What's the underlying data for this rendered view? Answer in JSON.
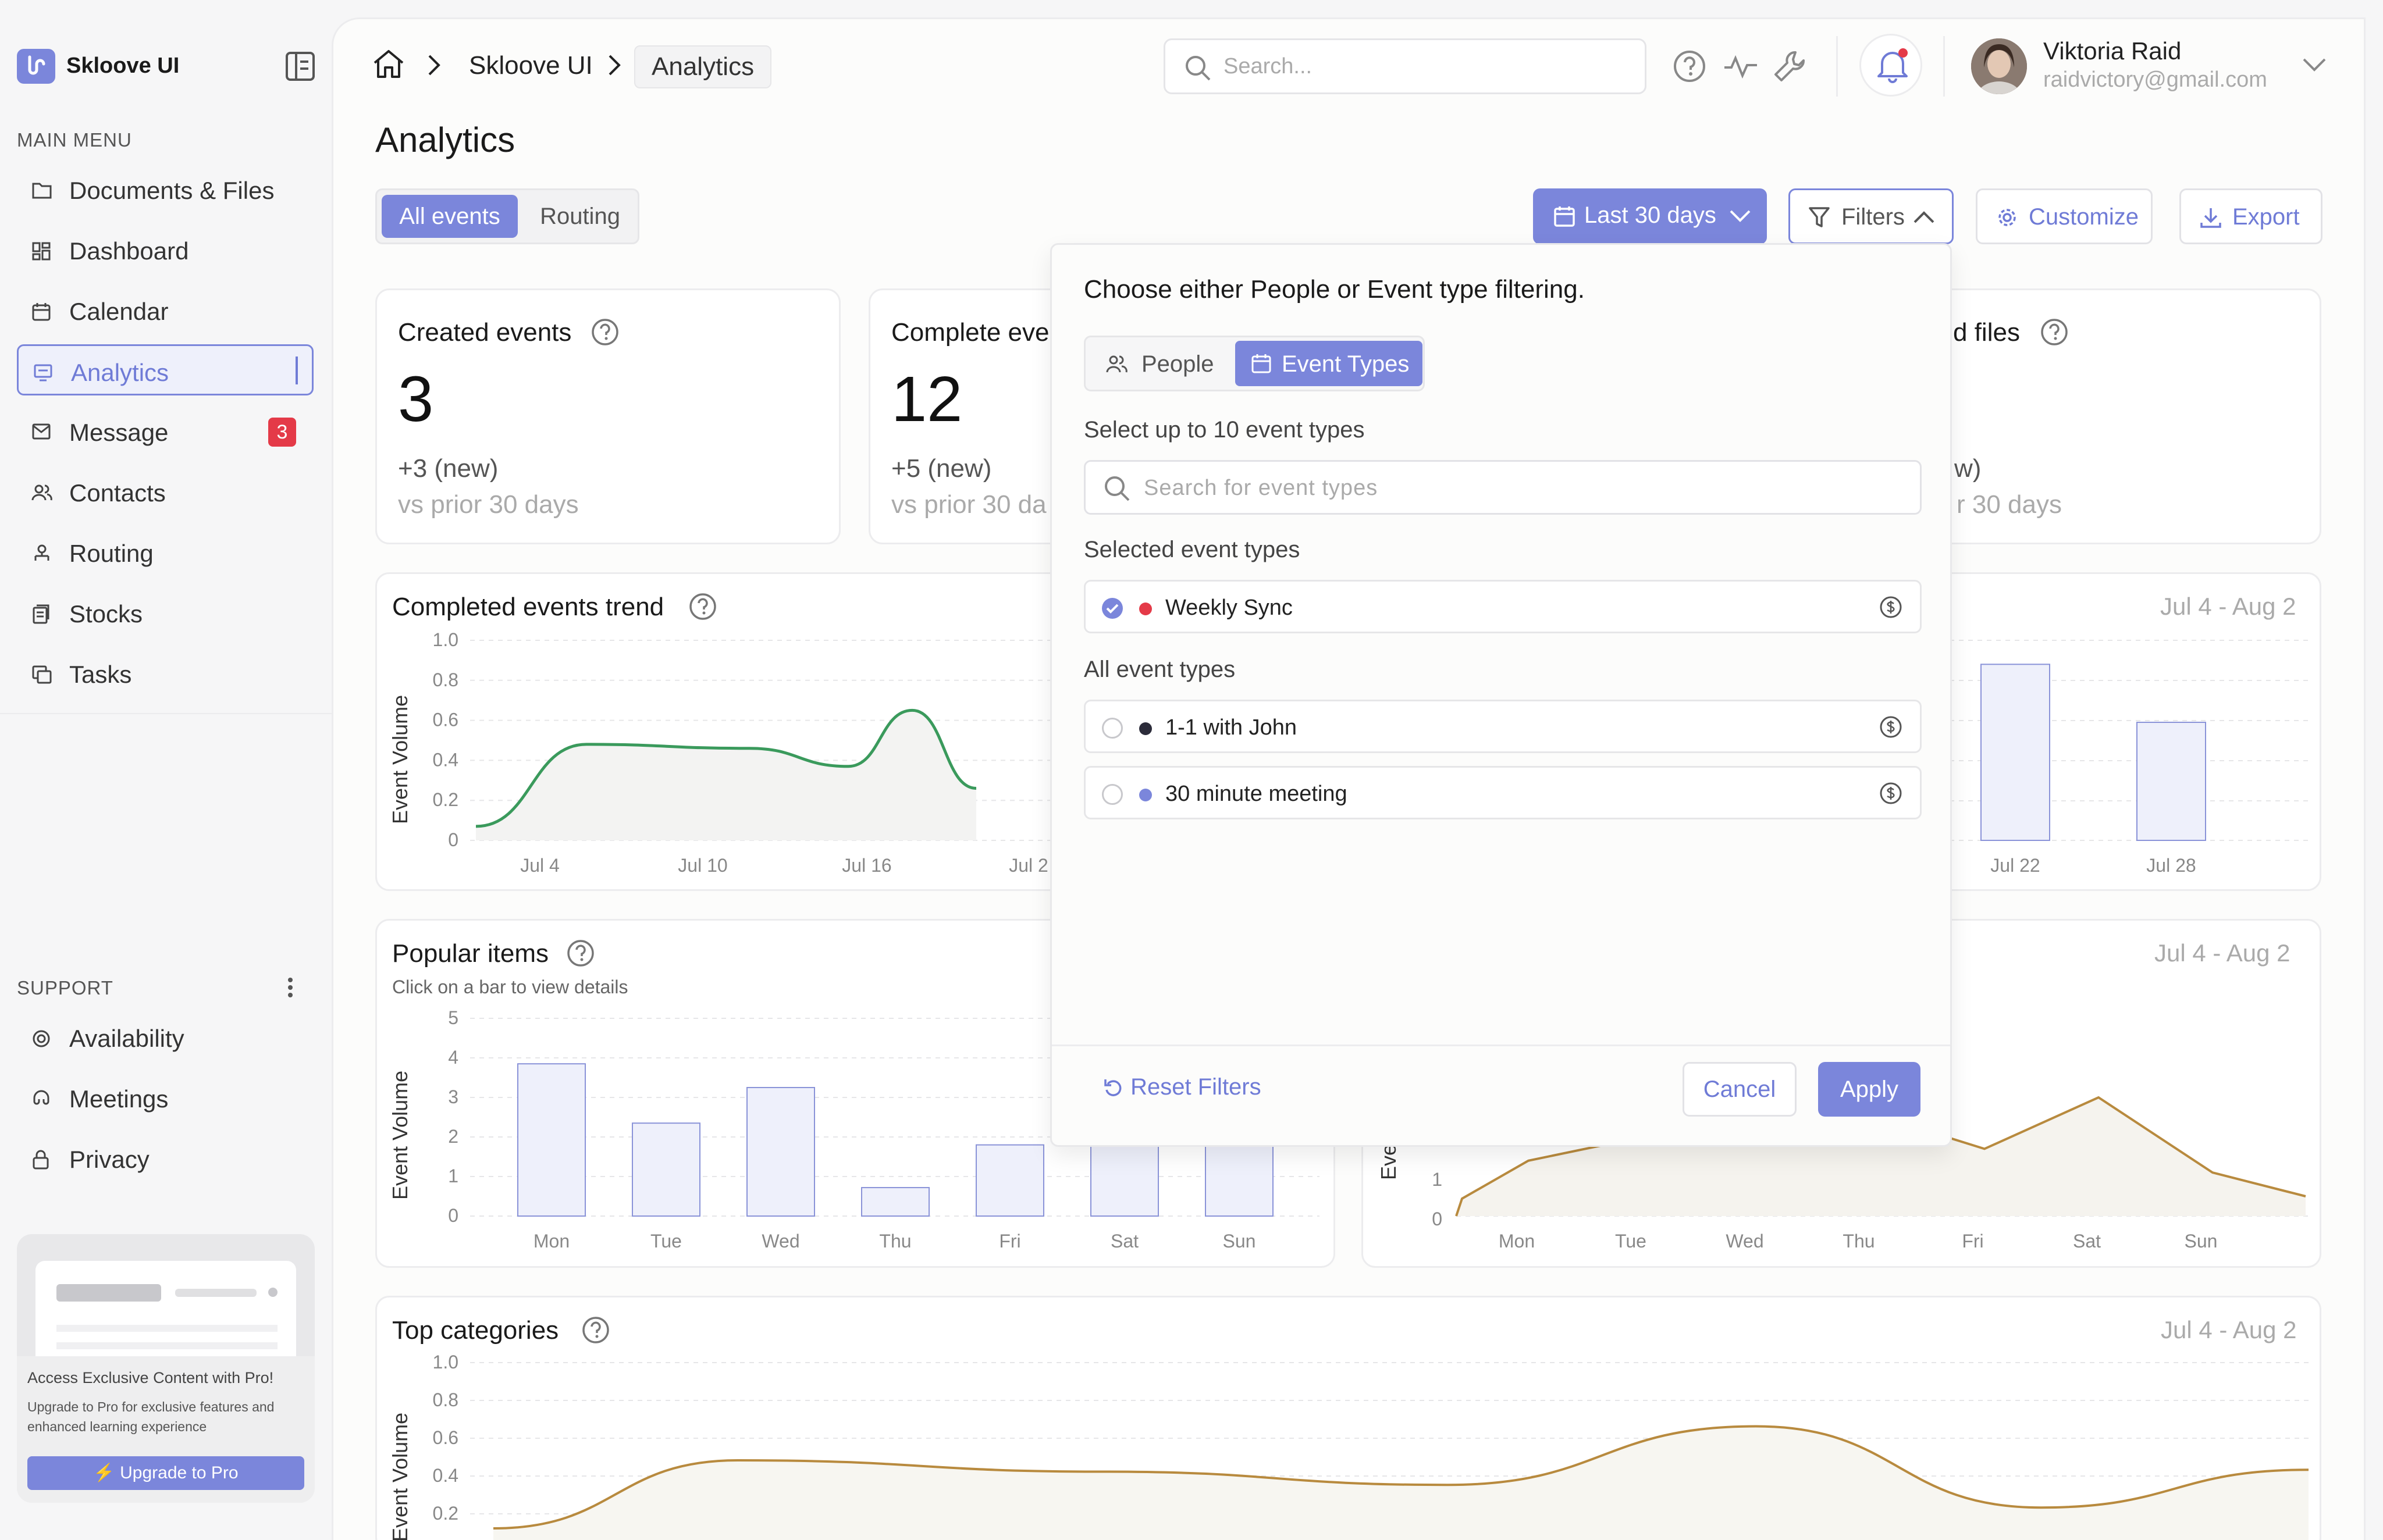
{
  "app": {
    "name": "Skloove UI"
  },
  "sidebar": {
    "main_menu_label": "MAIN MENU",
    "items": [
      {
        "label": "Documents & Files",
        "icon": "folder-icon"
      },
      {
        "label": "Dashboard",
        "icon": "dashboard-icon"
      },
      {
        "label": "Calendar",
        "icon": "calendar-icon"
      },
      {
        "label": "Analytics",
        "icon": "analytics-icon",
        "active": true
      },
      {
        "label": "Message",
        "icon": "mail-icon",
        "badge": "3"
      },
      {
        "label": "Contacts",
        "icon": "contacts-icon"
      },
      {
        "label": "Routing",
        "icon": "routing-icon"
      },
      {
        "label": "Stocks",
        "icon": "stocks-icon"
      },
      {
        "label": "Tasks",
        "icon": "tasks-icon"
      }
    ],
    "support_label": "SUPPORT",
    "support_items": [
      {
        "label": "Availability",
        "icon": "availability-icon"
      },
      {
        "label": "Meetings",
        "icon": "meetings-icon"
      },
      {
        "label": "Privacy",
        "icon": "lock-icon"
      }
    ],
    "promo": {
      "title": "Access Exclusive Content with Pro!",
      "subtitle": "Upgrade to Pro for exclusive features and enhanced learning experience",
      "button": "Upgrade to Pro"
    }
  },
  "header": {
    "breadcrumb": [
      "Skloove UI",
      "Analytics"
    ],
    "search_placeholder": "Search...",
    "user_name": "Viktoria Raid",
    "user_email": "raidvictory@gmail.com"
  },
  "page": {
    "title": "Analytics",
    "tabs": [
      "All events",
      "Routing"
    ],
    "date_button": "Last 30 days",
    "filters_button": "Filters",
    "customize_button": "Customize",
    "export_button": "Export"
  },
  "stats": [
    {
      "title": "Created events",
      "value": "3",
      "delta": "+3 (new)",
      "compare": "vs prior 30 days"
    },
    {
      "title": "Complete eve",
      "value": "12",
      "delta": "+5 (new)",
      "compare": "vs prior 30 da"
    },
    {
      "title": "d files",
      "delta": "w)",
      "compare": "r 30 days"
    }
  ],
  "date_range": "Jul 4 - Aug 2",
  "charts": {
    "trend": {
      "title": "Completed events trend",
      "ylabel": "Event Volume"
    },
    "popular": {
      "title": "Popular items",
      "subtitle": "Click on a bar to view details",
      "ylabel": "Event Volume"
    },
    "right_axis_partial": "Eve",
    "categories": {
      "title": "Top categories",
      "ylabel": "Event Volume"
    }
  },
  "chart_data": [
    {
      "type": "line",
      "title": "Completed events trend",
      "ylabel": "Event Volume",
      "ylim": [
        0,
        1.0
      ],
      "yticks": [
        "1.0",
        "0.8",
        "0.6",
        "0.4",
        "0.2",
        "0"
      ],
      "xticks": [
        "Jul 4",
        "Jul 10",
        "Jul 16",
        "Jul 2"
      ],
      "color": "#3a9a5c",
      "x": [
        0,
        1,
        2,
        3,
        4,
        5
      ],
      "values": [
        0.07,
        0.48,
        0.46,
        0.37,
        0.65,
        0.26
      ]
    },
    {
      "type": "bar",
      "title": "",
      "ylim": [
        0,
        1.0
      ],
      "xticks": [
        "Jul 22",
        "Jul 28"
      ],
      "categories": [
        "Jul 22",
        "Jul 28"
      ],
      "values": [
        0.88,
        0.59
      ]
    },
    {
      "type": "bar",
      "title": "Popular items",
      "ylabel": "Event Volume",
      "ylim": [
        0,
        5
      ],
      "yticks": [
        "5",
        "4",
        "3",
        "2",
        "1",
        "0"
      ],
      "categories": [
        "Mon",
        "Tue",
        "Wed",
        "Thu",
        "Fri",
        "Sat",
        "Sun"
      ],
      "values": [
        3.85,
        2.35,
        3.25,
        0.72,
        1.8,
        1.8,
        1.8
      ]
    },
    {
      "type": "area",
      "title": "",
      "ylim": [
        0,
        5
      ],
      "yticks": [
        "1",
        "0"
      ],
      "categories": [
        "Mon",
        "Tue",
        "Wed",
        "Thu",
        "Fri",
        "Sat",
        "Sun"
      ],
      "color": "#b88a3e",
      "values": [
        1.4,
        2.0,
        2.6,
        2.6,
        1.7,
        3.0,
        1.1
      ]
    },
    {
      "type": "line",
      "title": "Top categories",
      "ylabel": "Event Volume",
      "ylim": [
        0,
        1.0
      ],
      "yticks": [
        "1.0",
        "0.8",
        "0.6",
        "0.4",
        "0.2"
      ],
      "color": "#b88a3e",
      "x": [
        0,
        1,
        2,
        3,
        4,
        5,
        6,
        7
      ],
      "values": [
        0.12,
        0.48,
        0.42,
        0.35,
        0.66,
        0.23,
        0.43,
        0.5
      ]
    }
  ],
  "popover": {
    "heading": "Choose either People or Event type filtering.",
    "toggle_people": "People",
    "toggle_events": "Event Types",
    "select_label": "Select up to 10 event types",
    "search_placeholder": "Search for event types",
    "selected_label": "Selected event types",
    "selected": [
      {
        "name": "Weekly Sync",
        "color": "#e43a48"
      }
    ],
    "all_label": "All event types",
    "all": [
      {
        "name": "1-1 with John",
        "color": "#2c2c3a"
      },
      {
        "name": "30 minute meeting",
        "color": "#7b86db"
      }
    ],
    "reset": "Reset Filters",
    "cancel": "Cancel",
    "apply": "Apply"
  },
  "colors": {
    "accent": "#7b86db",
    "badge": "#e43a48"
  }
}
